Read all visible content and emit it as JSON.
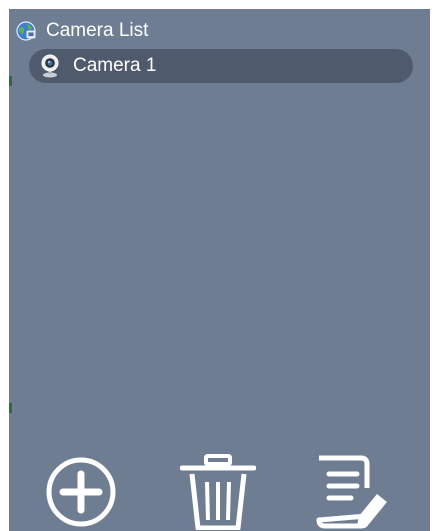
{
  "tree": {
    "root_label": "Camera List",
    "root_icon": "network-globe-icon",
    "items": [
      {
        "label": "Camera 1",
        "icon": "webcam-icon",
        "selected": true
      }
    ]
  },
  "toolbar": {
    "buttons": [
      {
        "name": "add",
        "icon": "plus-circle-icon"
      },
      {
        "name": "delete",
        "icon": "trash-icon"
      },
      {
        "name": "edit",
        "icon": "edit-note-icon"
      }
    ]
  },
  "colors": {
    "panel_background": "#6f7d93",
    "selected_item_background": "#4f5a6d",
    "text": "#ffffff"
  }
}
